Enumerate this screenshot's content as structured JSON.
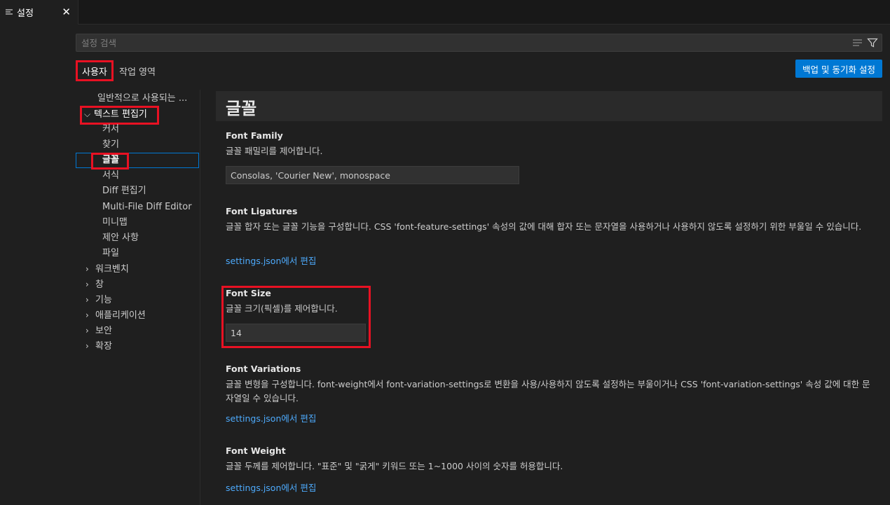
{
  "tab": {
    "label": "설정",
    "close": "✕"
  },
  "search": {
    "placeholder": "설정 검색"
  },
  "scopes": {
    "user": "사용자",
    "workspace": "작업 영역"
  },
  "sync_button": "백업 및 동기화 설정",
  "toc": {
    "common": "일반적으로 사용되는 ...",
    "text_editor": "텍스트 편집기",
    "children": [
      "커서",
      "찾기",
      "글꼴",
      "서식",
      "Diff 편집기",
      "Multi-File Diff Editor",
      "미니맵",
      "제안 사항",
      "파일"
    ],
    "collapsed": [
      "워크벤치",
      "창",
      "기능",
      "애플리케이션",
      "보안",
      "확장"
    ]
  },
  "section_title": "글꼴",
  "settings": {
    "font_family": {
      "title": "Font Family",
      "desc": "글꼴 패밀리를 제어합니다.",
      "value": "Consolas, 'Courier New', monospace"
    },
    "font_ligatures": {
      "title": "Font Ligatures",
      "desc": "글꼴 합자 또는 글꼴 기능을 구성합니다. CSS 'font-feature-settings' 속성의 값에 대해 합자 또는 문자열을 사용하거나 사용하지 않도록 설정하기 위한 부울일 수 있습니다.",
      "link": "settings.json에서 편집"
    },
    "font_size": {
      "title": "Font Size",
      "desc": "글꼴 크기(픽셀)를 제어합니다.",
      "value": "14"
    },
    "font_variations": {
      "title": "Font Variations",
      "desc": "글꼴 변형을 구성합니다. font-weight에서 font-variation-settings로 변환을 사용/사용하지 않도록 설정하는 부울이거나 CSS 'font-variation-settings' 속성 값에 대한 문자열일 수 있습니다.",
      "link": "settings.json에서 편집"
    },
    "font_weight": {
      "title": "Font Weight",
      "desc": "글꼴 두께를 제어합니다. \"표준\" 및 \"굵게\" 키워드 또는 1~1000 사이의 숫자를 허용합니다.",
      "link": "settings.json에서 편집"
    }
  },
  "colors": {
    "accent": "#0078d4",
    "highlight": "#e81123",
    "link": "#4daafc"
  }
}
